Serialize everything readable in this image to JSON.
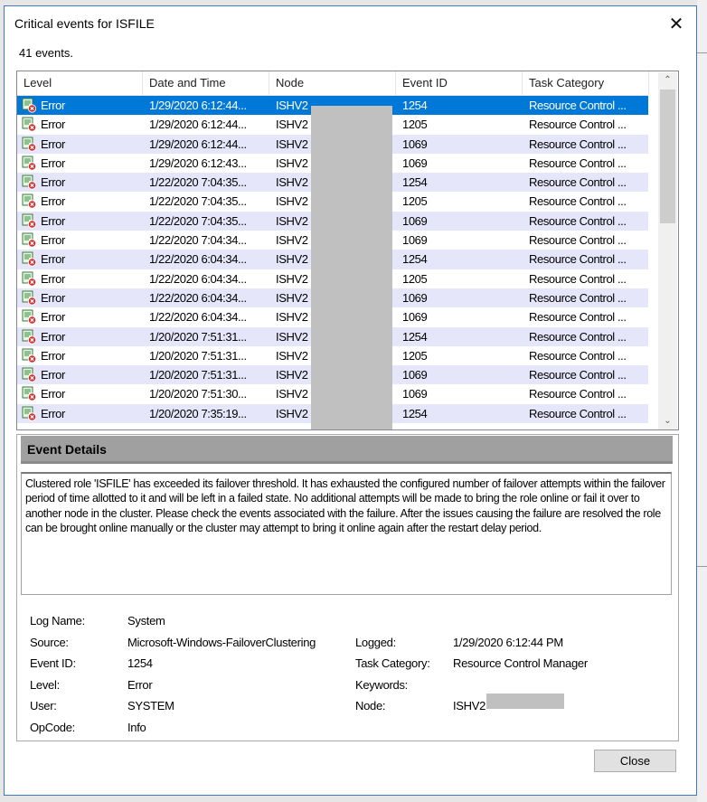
{
  "window": {
    "title": "Critical events for ISFILE",
    "close_glyph": "✕"
  },
  "event_count": "41 events.",
  "columns": [
    "Level",
    "Date and Time",
    "Node",
    "Event ID",
    "Task Category"
  ],
  "rows": [
    {
      "level": "Error",
      "datetime": "1/29/2020 6:12:44...",
      "node": "ISHV2",
      "event_id": "1254",
      "task": "Resource Control ...",
      "selected": true
    },
    {
      "level": "Error",
      "datetime": "1/29/2020 6:12:44...",
      "node": "ISHV2",
      "event_id": "1205",
      "task": "Resource Control ..."
    },
    {
      "level": "Error",
      "datetime": "1/29/2020 6:12:44...",
      "node": "ISHV2",
      "event_id": "1069",
      "task": "Resource Control ..."
    },
    {
      "level": "Error",
      "datetime": "1/29/2020 6:12:43...",
      "node": "ISHV2",
      "event_id": "1069",
      "task": "Resource Control ..."
    },
    {
      "level": "Error",
      "datetime": "1/22/2020 7:04:35...",
      "node": "ISHV2",
      "event_id": "1254",
      "task": "Resource Control ..."
    },
    {
      "level": "Error",
      "datetime": "1/22/2020 7:04:35...",
      "node": "ISHV2",
      "event_id": "1205",
      "task": "Resource Control ..."
    },
    {
      "level": "Error",
      "datetime": "1/22/2020 7:04:35...",
      "node": "ISHV2",
      "event_id": "1069",
      "task": "Resource Control ..."
    },
    {
      "level": "Error",
      "datetime": "1/22/2020 7:04:34...",
      "node": "ISHV2",
      "event_id": "1069",
      "task": "Resource Control ..."
    },
    {
      "level": "Error",
      "datetime": "1/22/2020 6:04:34...",
      "node": "ISHV2",
      "event_id": "1254",
      "task": "Resource Control ..."
    },
    {
      "level": "Error",
      "datetime": "1/22/2020 6:04:34...",
      "node": "ISHV2",
      "event_id": "1205",
      "task": "Resource Control ..."
    },
    {
      "level": "Error",
      "datetime": "1/22/2020 6:04:34...",
      "node": "ISHV2",
      "event_id": "1069",
      "task": "Resource Control ..."
    },
    {
      "level": "Error",
      "datetime": "1/22/2020 6:04:34...",
      "node": "ISHV2",
      "event_id": "1069",
      "task": "Resource Control ..."
    },
    {
      "level": "Error",
      "datetime": "1/20/2020 7:51:31...",
      "node": "ISHV2",
      "event_id": "1254",
      "task": "Resource Control ..."
    },
    {
      "level": "Error",
      "datetime": "1/20/2020 7:51:31...",
      "node": "ISHV2",
      "event_id": "1205",
      "task": "Resource Control ..."
    },
    {
      "level": "Error",
      "datetime": "1/20/2020 7:51:31...",
      "node": "ISHV2",
      "event_id": "1069",
      "task": "Resource Control ..."
    },
    {
      "level": "Error",
      "datetime": "1/20/2020 7:51:30...",
      "node": "ISHV2",
      "event_id": "1069",
      "task": "Resource Control ..."
    },
    {
      "level": "Error",
      "datetime": "1/20/2020 7:35:19...",
      "node": "ISHV2",
      "event_id": "1254",
      "task": "Resource Control ..."
    }
  ],
  "scroll_icons": {
    "up": "⌃",
    "down": "⌄"
  },
  "details": {
    "header": "Event Details",
    "description": "Clustered role 'ISFILE' has exceeded its failover threshold.  It has exhausted the configured number of failover attempts within the failover period of time allotted to it and will be left in a failed state.  No additional attempts will be made to bring the role online or fail it over to another node in the cluster.  Please check the events associated with the failure.  After the issues causing the failure are resolved the role can be brought online manually or the cluster may attempt to bring it online again after the restart delay period."
  },
  "properties": {
    "log_name_label": "Log Name:",
    "log_name": "System",
    "source_label": "Source:",
    "source": "Microsoft-Windows-FailoverClustering",
    "event_id_label": "Event ID:",
    "event_id": "1254",
    "level_label": "Level:",
    "level": "Error",
    "user_label": "User:",
    "user": "SYSTEM",
    "opcode_label": "OpCode:",
    "opcode": "Info",
    "logged_label": "Logged:",
    "logged": "1/29/2020 6:12:44 PM",
    "task_label": "Task Category:",
    "task": "Resource Control Manager",
    "keywords_label": "Keywords:",
    "node_label": "Node:",
    "node": "ISHV2"
  },
  "buttons": {
    "close": "Close"
  },
  "colors": {
    "selection": "#0078d7",
    "alt_row": "#e6e6fa",
    "header_gray": "#a0a0a0"
  }
}
